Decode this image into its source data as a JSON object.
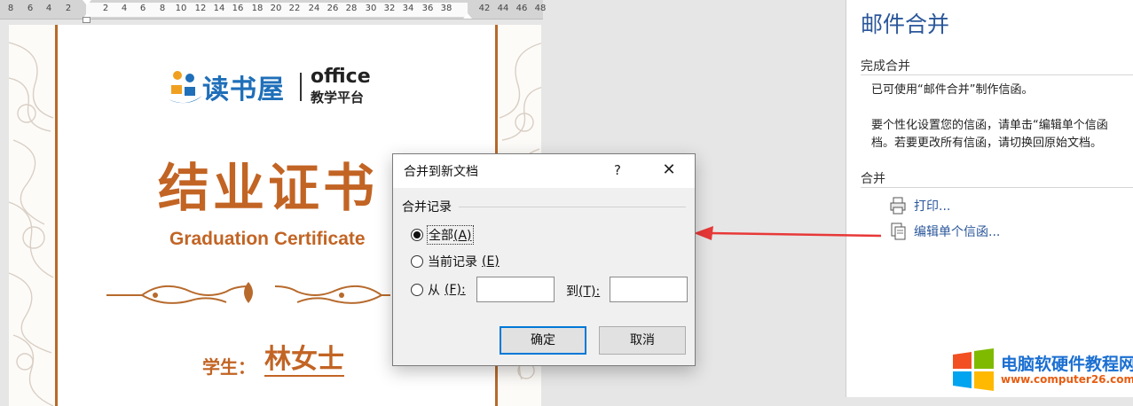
{
  "ruler": {
    "ticks_left": [
      "8",
      "6",
      "4",
      "2"
    ],
    "ticks_main": [
      "2",
      "4",
      "6",
      "8",
      "10",
      "12",
      "14",
      "16",
      "18",
      "20",
      "22",
      "24",
      "26",
      "28",
      "30",
      "32",
      "34",
      "36",
      "38"
    ],
    "ticks_right": [
      "42",
      "44",
      "46",
      "48"
    ]
  },
  "certificate": {
    "logo_brand": "读书屋",
    "logo_word": "office",
    "logo_sub": "教学平台",
    "title": "结业证书",
    "subtitle": "Graduation Certificate",
    "student_label": "学生：",
    "student_name": "林女士",
    "accent_color": "#c26424"
  },
  "pane": {
    "title": "邮件合并",
    "section1": "完成合并",
    "line1": "已可使用“邮件合并”制作信函。",
    "line2": "要个性化设置您的信函，请单击“编辑单个信函",
    "line3": "档。若要更改所有信函，请切换回原始文档。",
    "section2": "合并",
    "print_link": "打印...",
    "edit_link": "编辑单个信函..."
  },
  "dialog": {
    "title": "合并到新文档",
    "help": "?",
    "close": "✕",
    "group": "合并记录",
    "opt_all": "全部",
    "opt_all_key": "(A)",
    "opt_current": "当前记录",
    "opt_current_key": "(E)",
    "opt_from": "从",
    "opt_from_key": "(F):",
    "from_value": "",
    "to_label": "到",
    "to_key": "(T):",
    "to_value": "",
    "ok": "确定",
    "cancel": "取消"
  },
  "watermark": {
    "title": "电脑软硬件教程网",
    "url": "www.computer26.com"
  }
}
